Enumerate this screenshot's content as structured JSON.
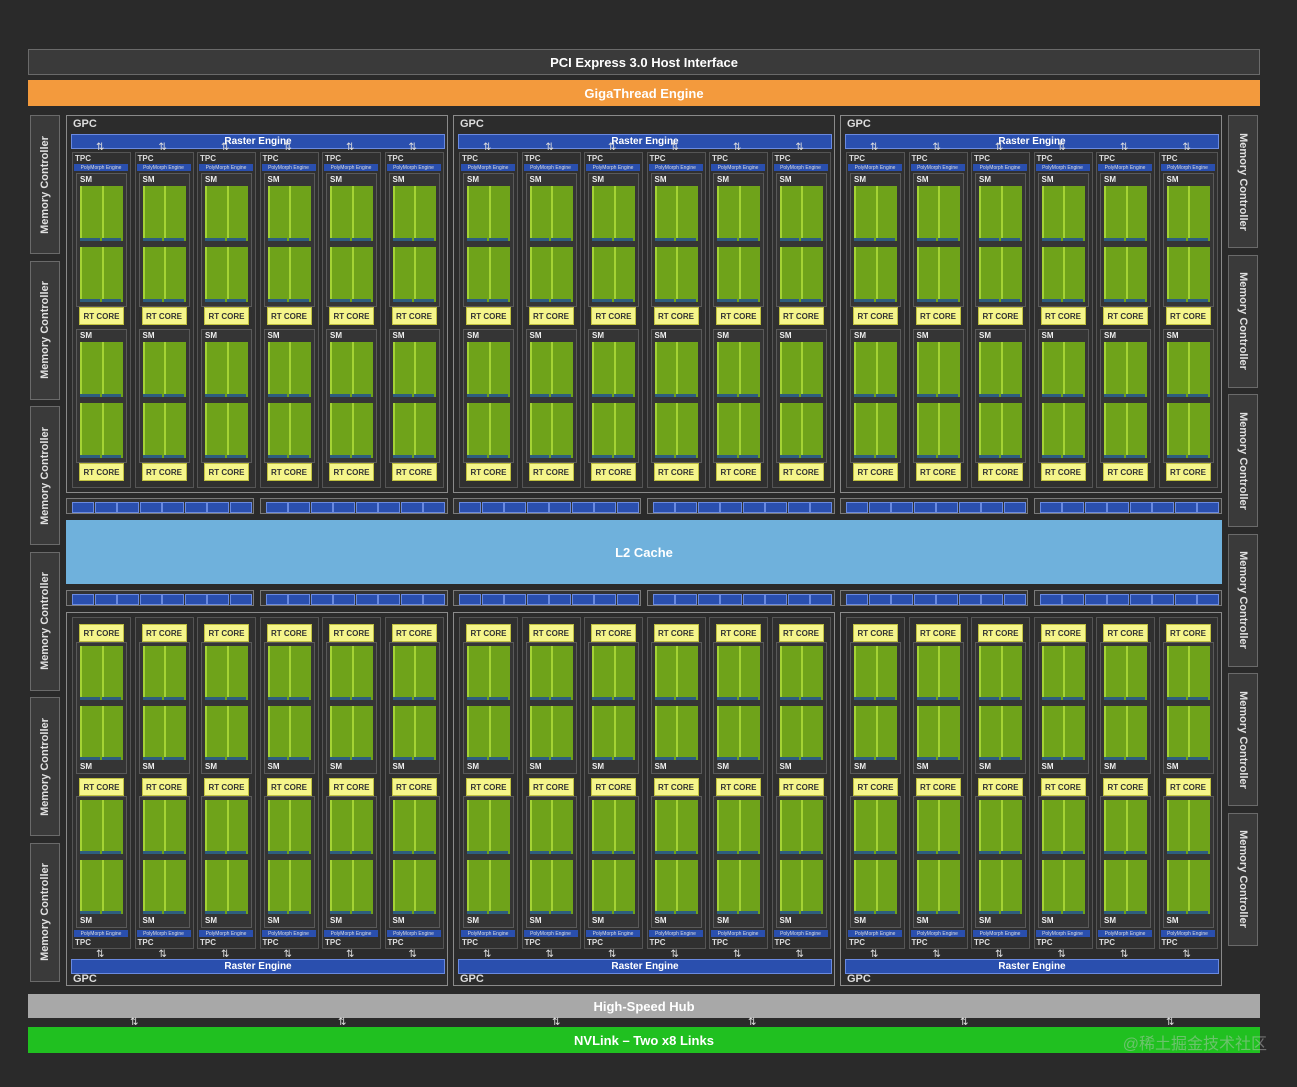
{
  "pci": "PCI Express 3.0 Host Interface",
  "giga": "GigaThread Engine",
  "memory_controller": "Memory Controller",
  "gpc": "GPC",
  "raster_engine": "Raster Engine",
  "tpc": "TPC",
  "polymorph": "PolyMorph Engine",
  "sm": "SM",
  "rt_core": "RT CORE",
  "l2_cache": "L2 Cache",
  "hub": "High-Speed Hub",
  "nvlink": "NVLink – Two x8 Links",
  "watermark": "@稀土掘金技术社区",
  "colors": {
    "background": "#2a2a2a",
    "giga_thread": "#f39a3d",
    "nvlink": "#20c020",
    "l2_cache": "#6fb1dc",
    "raster_engine": "#2a4fae",
    "rt_core": "#f5f58a",
    "cuda_core": "#6fa31a",
    "hub": "#a8a8a8"
  },
  "layout_counts": {
    "gpcs": 6,
    "tpcs_per_gpc": 6,
    "sms_per_tpc": 2,
    "memory_controllers": 12
  }
}
